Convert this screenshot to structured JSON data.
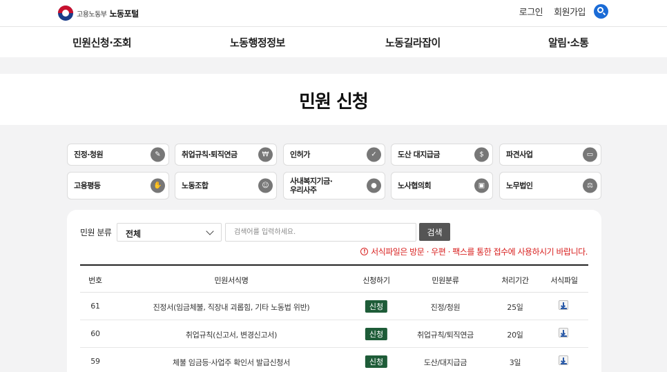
{
  "header": {
    "ministry": "고용노동부",
    "portal": "노동포털",
    "login": "로그인",
    "signup": "회원가입"
  },
  "gnb": [
    "민원신청·조회",
    "노동행정정보",
    "노동길라잡이",
    "알림·소통"
  ],
  "page": {
    "title": "민원 신청"
  },
  "categories": [
    {
      "label": "진정·청원",
      "icon": "document-pen-icon"
    },
    {
      "label": "취업규칙·퇴직연금",
      "icon": "coin-document-icon"
    },
    {
      "label": "인허가",
      "icon": "stamp-icon"
    },
    {
      "label": "도산 대지급금",
      "icon": "money-icon"
    },
    {
      "label": "파견사업",
      "icon": "briefcase-icon"
    },
    {
      "label": "고용평등",
      "icon": "handshake-icon"
    },
    {
      "label": "노동조합",
      "icon": "people-icon"
    },
    {
      "label": "사내복지기금·\n우리사주",
      "icon": "hand-coin-icon"
    },
    {
      "label": "노사협의회",
      "icon": "meeting-icon"
    },
    {
      "label": "노무법인",
      "icon": "scale-icon"
    }
  ],
  "filter": {
    "label": "민원 분류",
    "selected": "전체",
    "placeholder": "검색어를 입력하세요.",
    "search_button": "검색",
    "notice": "서식파일은 방문 · 우편 · 팩스를 통한 접수에 사용하시기 바랍니다."
  },
  "table": {
    "headers": [
      "번호",
      "민원서식명",
      "신청하기",
      "민원분류",
      "처리기간",
      "서식파일"
    ],
    "apply_label": "신청",
    "rows": [
      {
        "no": "61",
        "name": "진정서(임금체불, 직장내 괴롭힘, 기타 노동법 위반)",
        "category": "진정/청원",
        "period": "25일"
      },
      {
        "no": "60",
        "name": "취업규칙(신고서, 변경신고서)",
        "category": "취업규칙/퇴직연금",
        "period": "20일"
      },
      {
        "no": "59",
        "name": "체불 임금등·사업주 확인서 발급신청서",
        "category": "도산/대지급금",
        "period": "3일"
      }
    ]
  },
  "colors": {
    "accent": "#1a6bd6",
    "apply_green": "#1e5c38",
    "notice_red": "#d8201f",
    "background_gray": "#f3f3f4"
  }
}
